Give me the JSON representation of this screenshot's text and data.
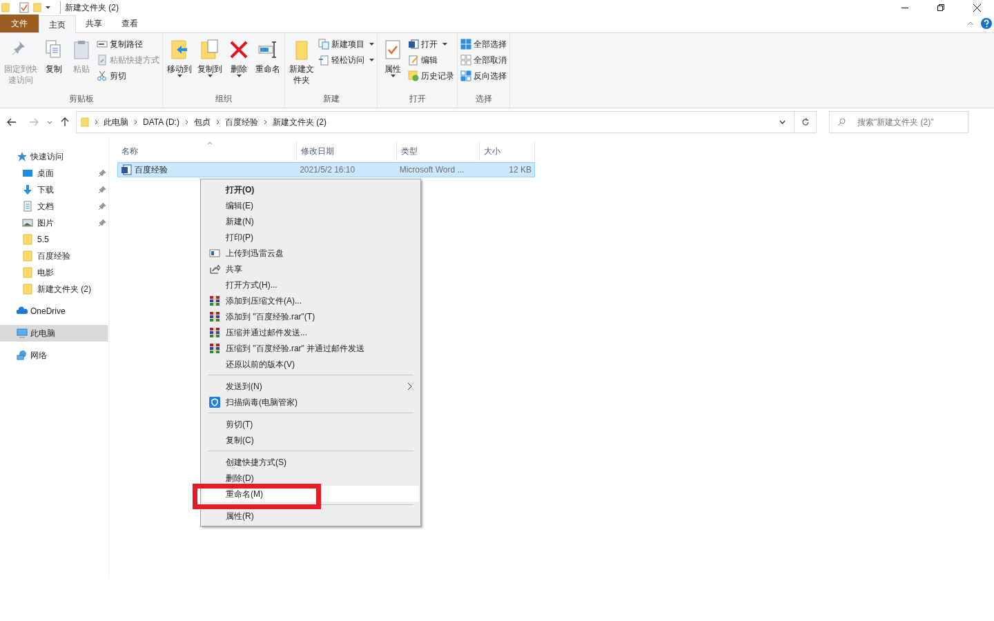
{
  "window": {
    "title": "新建文件夹 (2)"
  },
  "ribbon_tabs": [
    {
      "label": "文件",
      "kind": "file",
      "selected": false
    },
    {
      "label": "主页",
      "kind": "tab",
      "selected": true
    },
    {
      "label": "共享",
      "kind": "tab",
      "selected": false
    },
    {
      "label": "查看",
      "kind": "tab",
      "selected": false
    }
  ],
  "ribbon_groups": [
    {
      "label": "剪贴板",
      "items": [
        {
          "label": "固定到快速访问",
          "kind": "large",
          "disabled": true,
          "dropdown": false
        },
        {
          "label": "复制",
          "kind": "large",
          "disabled": false,
          "dropdown": false
        },
        {
          "label": "粘贴",
          "kind": "large",
          "disabled": true,
          "dropdown": false
        },
        {
          "label": "复制路径",
          "kind": "small",
          "disabled": false,
          "dropdown": false
        },
        {
          "label": "粘贴快捷方式",
          "kind": "small",
          "disabled": true,
          "dropdown": false
        },
        {
          "label": "剪切",
          "kind": "small",
          "disabled": false,
          "dropdown": false
        }
      ]
    },
    {
      "label": "组织",
      "items": [
        {
          "label": "移动到",
          "kind": "large",
          "disabled": false,
          "dropdown": true
        },
        {
          "label": "复制到",
          "kind": "large",
          "disabled": false,
          "dropdown": true
        },
        {
          "label": "删除",
          "kind": "large",
          "disabled": false,
          "dropdown": true
        },
        {
          "label": "重命名",
          "kind": "large",
          "disabled": false,
          "dropdown": false
        }
      ]
    },
    {
      "label": "新建",
      "items": [
        {
          "label": "新建文件夹",
          "kind": "large",
          "disabled": false,
          "dropdown": false
        },
        {
          "label": "新建项目",
          "kind": "small",
          "disabled": false,
          "dropdown": true
        },
        {
          "label": "轻松访问",
          "kind": "small",
          "disabled": false,
          "dropdown": true
        }
      ]
    },
    {
      "label": "打开",
      "items": [
        {
          "label": "属性",
          "kind": "large",
          "disabled": false,
          "dropdown": true
        },
        {
          "label": "打开",
          "kind": "small",
          "disabled": false,
          "dropdown": true
        },
        {
          "label": "编辑",
          "kind": "small",
          "disabled": false,
          "dropdown": false
        },
        {
          "label": "历史记录",
          "kind": "small",
          "disabled": false,
          "dropdown": false
        }
      ]
    },
    {
      "label": "选择",
      "items": [
        {
          "label": "全部选择",
          "kind": "small",
          "disabled": false,
          "dropdown": false
        },
        {
          "label": "全部取消",
          "kind": "small",
          "disabled": false,
          "dropdown": false
        },
        {
          "label": "反向选择",
          "kind": "small",
          "disabled": false,
          "dropdown": false
        }
      ]
    }
  ],
  "address_bar": {
    "path": [
      "此电脑",
      "DATA (D:)",
      "包贞",
      "百度经验",
      "新建文件夹 (2)"
    ]
  },
  "search": {
    "placeholder": "搜索\"新建文件夹 (2)\""
  },
  "sidebar": {
    "items": [
      {
        "label": "快速访问",
        "selected": false,
        "children": [
          {
            "label": "桌面",
            "pinned": true
          },
          {
            "label": "下载",
            "pinned": true
          },
          {
            "label": "文档",
            "pinned": true
          },
          {
            "label": "图片",
            "pinned": true
          },
          {
            "label": "5.5",
            "pinned": false
          },
          {
            "label": "百度经验",
            "pinned": false
          },
          {
            "label": "电影",
            "pinned": false
          },
          {
            "label": "新建文件夹 (2)",
            "pinned": false
          }
        ]
      },
      {
        "label": "OneDrive",
        "selected": false
      },
      {
        "label": "此电脑",
        "selected": true
      },
      {
        "label": "网络",
        "selected": false
      }
    ]
  },
  "table": {
    "columns": [
      {
        "label": "名称",
        "sorted": true
      },
      {
        "label": "修改日期",
        "sorted": false
      },
      {
        "label": "类型",
        "sorted": false
      },
      {
        "label": "大小",
        "sorted": false
      }
    ],
    "rows": [
      {
        "cells": [
          "百度经验",
          "2021/5/2 16:10",
          "Microsoft Word ...",
          "12 KB"
        ],
        "selected": true
      }
    ]
  },
  "context_menu": {
    "items": [
      {
        "kind": "item",
        "label": "打开(O)",
        "default": true,
        "submenu": false,
        "hovered": false,
        "annotated": false
      },
      {
        "kind": "item",
        "label": "编辑(E)",
        "default": false,
        "submenu": false,
        "hovered": false,
        "annotated": false
      },
      {
        "kind": "item",
        "label": "新建(N)",
        "default": false,
        "submenu": false,
        "hovered": false,
        "annotated": false
      },
      {
        "kind": "item",
        "label": "打印(P)",
        "default": false,
        "submenu": false,
        "hovered": false,
        "annotated": false
      },
      {
        "kind": "item",
        "label": "上传到迅雷云盘",
        "default": false,
        "submenu": false,
        "hovered": false,
        "annotated": false
      },
      {
        "kind": "item",
        "label": "共享",
        "default": false,
        "submenu": false,
        "hovered": false,
        "annotated": false
      },
      {
        "kind": "item",
        "label": "打开方式(H)...",
        "default": false,
        "submenu": false,
        "hovered": false,
        "annotated": false
      },
      {
        "kind": "item",
        "label": "添加到压缩文件(A)...",
        "default": false,
        "submenu": false,
        "hovered": false,
        "annotated": false
      },
      {
        "kind": "item",
        "label": "添加到 \"百度经验.rar\"(T)",
        "default": false,
        "submenu": false,
        "hovered": false,
        "annotated": false
      },
      {
        "kind": "item",
        "label": "压缩并通过邮件发送...",
        "default": false,
        "submenu": false,
        "hovered": false,
        "annotated": false
      },
      {
        "kind": "item",
        "label": "压缩到 \"百度经验.rar\" 并通过邮件发送",
        "default": false,
        "submenu": false,
        "hovered": false,
        "annotated": false
      },
      {
        "kind": "item",
        "label": "还原以前的版本(V)",
        "default": false,
        "submenu": false,
        "hovered": false,
        "annotated": false
      },
      {
        "kind": "separator"
      },
      {
        "kind": "item",
        "label": "发送到(N)",
        "default": false,
        "submenu": true,
        "hovered": false,
        "annotated": false
      },
      {
        "kind": "item",
        "label": "扫描病毒(电脑管家)",
        "default": false,
        "submenu": false,
        "hovered": false,
        "annotated": false
      },
      {
        "kind": "separator"
      },
      {
        "kind": "item",
        "label": "剪切(T)",
        "default": false,
        "submenu": false,
        "hovered": false,
        "annotated": false
      },
      {
        "kind": "item",
        "label": "复制(C)",
        "default": false,
        "submenu": false,
        "hovered": false,
        "annotated": false
      },
      {
        "kind": "separator"
      },
      {
        "kind": "item",
        "label": "创建快捷方式(S)",
        "default": false,
        "submenu": false,
        "hovered": false,
        "annotated": false
      },
      {
        "kind": "item",
        "label": "删除(D)",
        "default": false,
        "submenu": false,
        "hovered": false,
        "annotated": false
      },
      {
        "kind": "item",
        "label": "重命名(M)",
        "default": false,
        "submenu": false,
        "hovered": true,
        "annotated": true
      },
      {
        "kind": "separator"
      },
      {
        "kind": "item",
        "label": "属性(R)",
        "default": false,
        "submenu": false,
        "hovered": false,
        "annotated": false
      }
    ]
  }
}
